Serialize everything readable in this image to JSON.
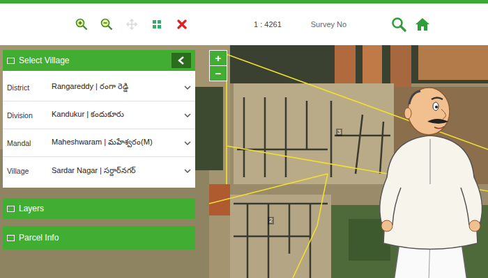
{
  "toolbar": {
    "scale": "1 : 4261",
    "search_label": "Survey No"
  },
  "panel": {
    "title": "Select Village",
    "fields": [
      {
        "label": "District",
        "value": "Rangareddy | రంగా రెడ్డి"
      },
      {
        "label": "Division",
        "value": "Kandukur | కందుకూరు"
      },
      {
        "label": "Mandal",
        "value": "Maheshwaram | మహేశ్వరం(M)"
      },
      {
        "label": "Village",
        "value": "Sardar Nagar | సర్దార్‌నగర్"
      }
    ]
  },
  "sections": [
    {
      "title": "Layers"
    },
    {
      "title": "Parcel Info"
    }
  ],
  "zoom": {
    "in": "+",
    "out": "−"
  },
  "map": {
    "parcels": [
      {
        "label": "3"
      },
      {
        "label": "2"
      }
    ]
  }
}
